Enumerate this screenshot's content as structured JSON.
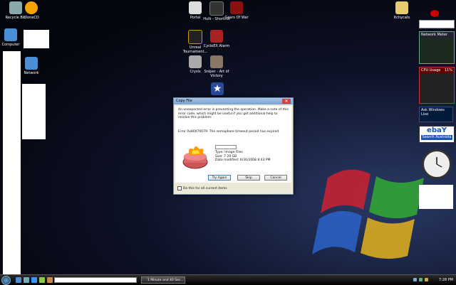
{
  "desktop": {
    "icons": [
      {
        "label": "Recycle Bin",
        "icon": "recycle-bin-icon",
        "color": "#8aa"
      },
      {
        "label": "CloneCD",
        "icon": "clonecd-icon",
        "color": "#f4a300"
      },
      {
        "label": "Computer",
        "icon": "computer-icon",
        "color": "#4a8fd6"
      },
      {
        "label": "Network",
        "icon": "network-icon",
        "color": "#4a8fd6"
      },
      {
        "label": "Portal",
        "icon": "portal-icon",
        "color": "#ddd"
      },
      {
        "label": "Hulk - Shortcut",
        "icon": "hulk-icon",
        "color": "#333"
      },
      {
        "label": "Gears Of War",
        "icon": "gears-of-war-icon",
        "color": "#8b1010"
      },
      {
        "label": "Unreal Tournament...",
        "icon": "unreal-tournament-icon",
        "color": "#222"
      },
      {
        "label": "CycleEX Alarm",
        "icon": "alarm-icon",
        "color": "#a22"
      },
      {
        "label": "Crysis",
        "icon": "crysis-icon",
        "color": "#aaa"
      },
      {
        "label": "Sniper - Art of Victory",
        "icon": "sniper-icon",
        "color": "#876"
      },
      {
        "label": "Itchycats",
        "icon": "folder-icon",
        "color": "#e8cd70"
      }
    ]
  },
  "gadgets": {
    "network_meter_title": "Network Meter",
    "cpu_title": "CPU Usage",
    "cpu_value": "11%",
    "ask_label": "Ask Windows Live",
    "ebay_label": "ebaY",
    "ebay_search": "Search Australia"
  },
  "dialog": {
    "title": "Copy File",
    "close_label": "✕",
    "message": "An unexpected error is preventing the operation. Make a note of this error code, which might be useful if you get additional help to resolve this problem:",
    "error": "Error 0x80070079: The semaphore timeout period has expired.",
    "file_type": "Type: Image Files",
    "file_size": "Size: 7.29 GB",
    "file_date": "Date modified: 6/30/2008 8:43 PM",
    "try_again": "Try Again",
    "skip": "Skip",
    "cancel": "Cancel",
    "checkbox_label": "Do this for all current items"
  },
  "taskbar": {
    "task_label": "1 Minute and 40 Sec...",
    "clock": "7:28 PM"
  }
}
